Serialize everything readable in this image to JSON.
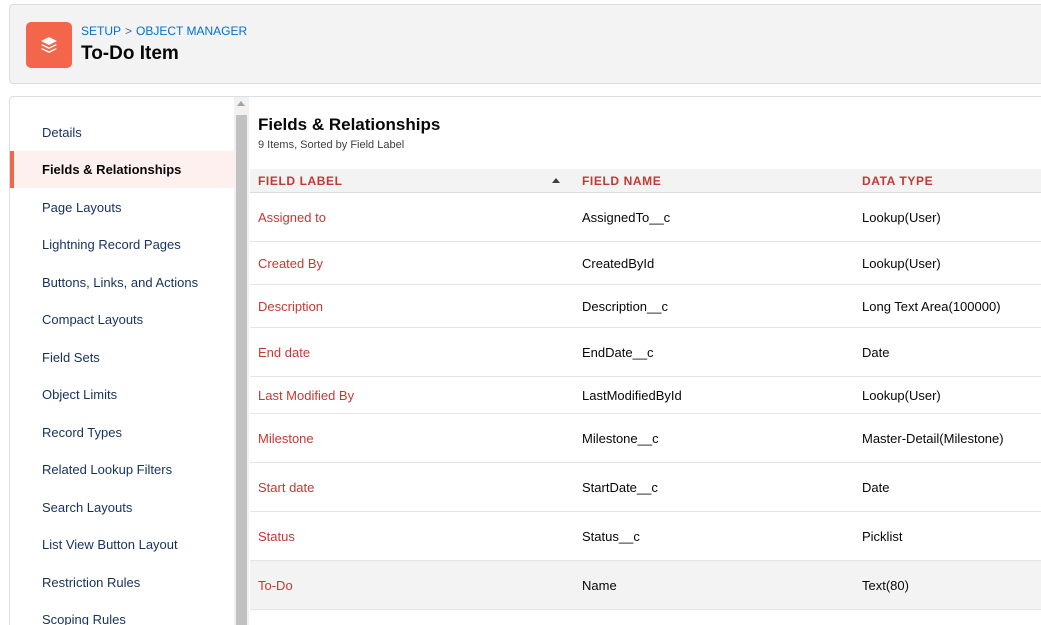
{
  "header": {
    "icon": "stacked-layers-icon",
    "breadcrumb": {
      "setup": "SETUP",
      "separator": ">",
      "object_manager": "OBJECT MANAGER"
    },
    "title": "To-Do Item"
  },
  "sidebar": {
    "items": [
      {
        "label": "Details"
      },
      {
        "label": "Fields & Relationships",
        "active": true
      },
      {
        "label": "Page Layouts"
      },
      {
        "label": "Lightning Record Pages"
      },
      {
        "label": "Buttons, Links, and Actions"
      },
      {
        "label": "Compact Layouts"
      },
      {
        "label": "Field Sets"
      },
      {
        "label": "Object Limits"
      },
      {
        "label": "Record Types"
      },
      {
        "label": "Related Lookup Filters"
      },
      {
        "label": "Search Layouts"
      },
      {
        "label": "List View Button Layout"
      },
      {
        "label": "Restriction Rules"
      },
      {
        "label": "Scoping Rules"
      }
    ]
  },
  "content": {
    "title": "Fields & Relationships",
    "subtitle": "9 Items, Sorted by Field Label",
    "columns": [
      "FIELD LABEL",
      "FIELD NAME",
      "DATA TYPE"
    ],
    "sort_icon": "arrow-up-icon",
    "rows": [
      {
        "label": "Assigned to",
        "name": "AssignedTo__c",
        "type": "Lookup(User)"
      },
      {
        "label": "Created By",
        "name": "CreatedById",
        "type": "Lookup(User)"
      },
      {
        "label": "Description",
        "name": "Description__c",
        "type": "Long Text Area(100000)"
      },
      {
        "label": "End date",
        "name": "EndDate__c",
        "type": "Date"
      },
      {
        "label": "Last Modified By",
        "name": "LastModifiedById",
        "type": "Lookup(User)"
      },
      {
        "label": "Milestone",
        "name": "Milestone__c",
        "type": "Master-Detail(Milestone)"
      },
      {
        "label": "Start date",
        "name": "StartDate__c",
        "type": "Date"
      },
      {
        "label": "Status",
        "name": "Status__c",
        "type": "Picklist"
      },
      {
        "label": "To-Do",
        "name": "Name",
        "type": "Text(80)",
        "hover": true
      }
    ]
  },
  "colors": {
    "brand": "#f4664b",
    "link_red": "#c23934",
    "breadcrumb_blue": "#0070d2",
    "active_nav_bg": "#fef0ee"
  }
}
